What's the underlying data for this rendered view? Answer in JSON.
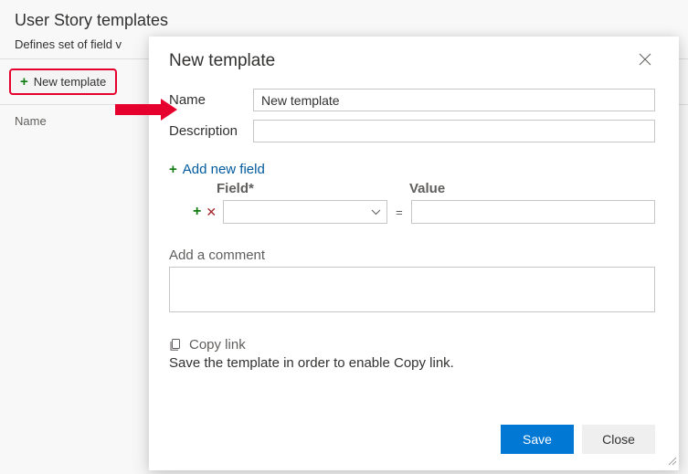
{
  "page": {
    "title": "User Story templates",
    "description_visible": "Defines set of field v",
    "name_column": "Name"
  },
  "toolbar": {
    "new_template_label": "New template"
  },
  "dialog": {
    "title": "New template",
    "name_label": "Name",
    "name_value": "New template",
    "description_label": "Description",
    "description_value": "",
    "add_field_label": "Add new field",
    "field_header": "Field*",
    "value_header": "Value",
    "equals": "=",
    "comment_label": "Add a comment",
    "comment_value": "",
    "copy_link_label": "Copy link",
    "copy_link_msg": "Save the template in order to enable Copy link.",
    "save_label": "Save",
    "close_label": "Close"
  }
}
